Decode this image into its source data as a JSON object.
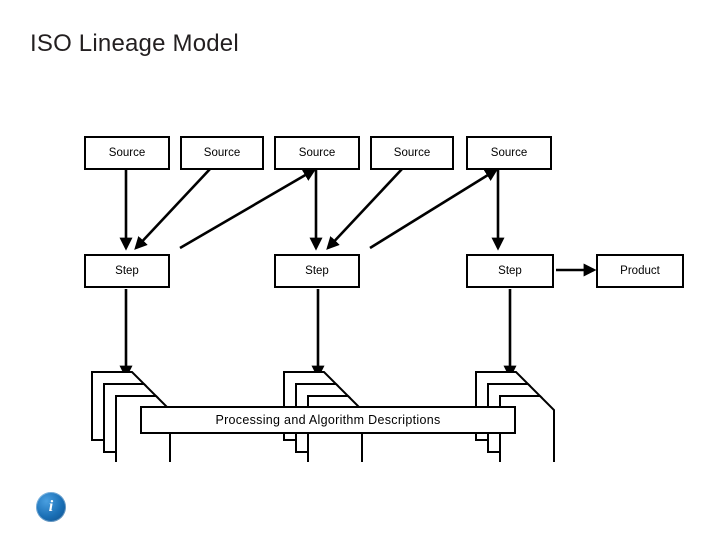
{
  "slide": {
    "title": "ISO Lineage Model",
    "background_color": "#ffffff",
    "text_color": "#231f20",
    "badge": {
      "icon": "info-icon",
      "label": "i",
      "color": "#1a6fb5"
    }
  },
  "diagram": {
    "type": "flow",
    "line_color": "#000000",
    "node_fill": "#ffffff",
    "sources": [
      {
        "label": "Source"
      },
      {
        "label": "Source"
      },
      {
        "label": "Source"
      },
      {
        "label": "Source"
      },
      {
        "label": "Source"
      }
    ],
    "steps": [
      {
        "label": "Step"
      },
      {
        "label": "Step"
      },
      {
        "label": "Step"
      }
    ],
    "product": {
      "label": "Product"
    },
    "band": {
      "label": "Processing and Algorithm Descriptions"
    },
    "document_stacks": 3,
    "connections": [
      {
        "from": "Source 1",
        "to": "Step 1"
      },
      {
        "from": "Source 2",
        "to": "Step 1"
      },
      {
        "from": "Source 3",
        "to": "Step 2"
      },
      {
        "from": "Source 4",
        "to": "Step 2"
      },
      {
        "from": "Source 5",
        "to": "Step 3"
      },
      {
        "from": "Step 3",
        "to": "Product"
      },
      {
        "from": "Step 1",
        "to": "Documents 1"
      },
      {
        "from": "Step 2",
        "to": "Documents 2"
      },
      {
        "from": "Step 3",
        "to": "Documents 3"
      }
    ]
  }
}
